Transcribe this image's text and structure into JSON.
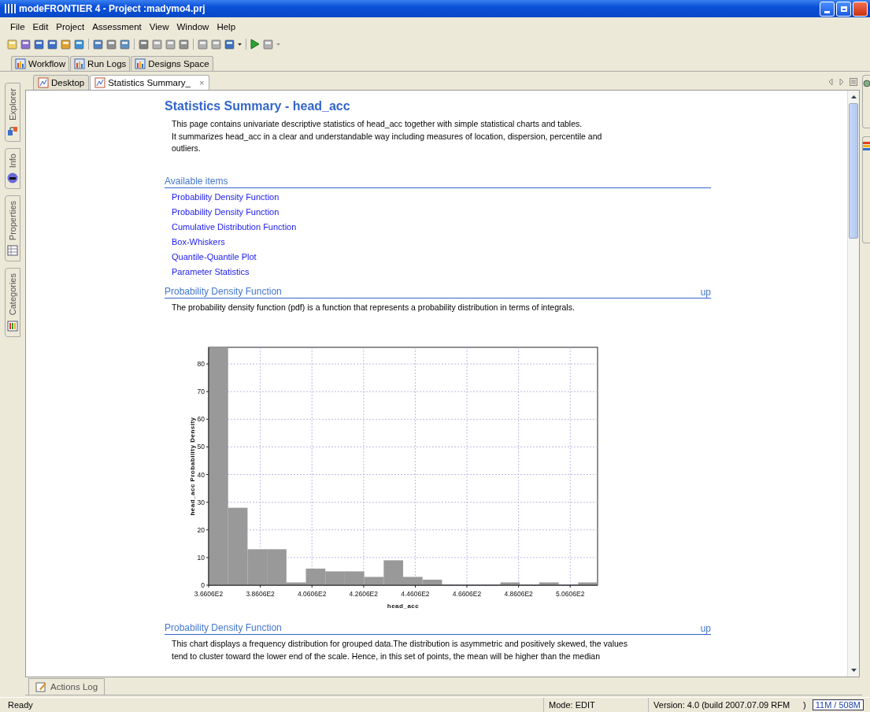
{
  "window": {
    "title": "modeFRONTIER 4 - Project :madymo4.prj"
  },
  "menu": [
    "File",
    "Edit",
    "Project",
    "Assessment",
    "View",
    "Window",
    "Help"
  ],
  "perspective_tabs": [
    {
      "label": "Workflow",
      "selected": false
    },
    {
      "label": "Run Logs",
      "selected": false
    },
    {
      "label": "Designs Space",
      "selected": false
    }
  ],
  "side_tabs": [
    {
      "label": "Explorer",
      "kind": "explorer"
    },
    {
      "label": "Info",
      "kind": "info"
    },
    {
      "label": "Properties",
      "kind": "properties"
    },
    {
      "label": "Categories",
      "kind": "categories"
    }
  ],
  "editor_tabs": [
    {
      "label": "Desktop",
      "selected": false
    },
    {
      "label": "Statistics Summary_",
      "selected": true,
      "close": "×"
    }
  ],
  "page": {
    "title": "Statistics Summary - head_acc",
    "intro": "This page contains univariate descriptive statistics of head_acc together with simple statistical charts and tables.\nIt summarizes head_acc in a clear and understandable way including measures of location, dispersion, percentile and\noutliers.",
    "available_items": {
      "heading": "Available items",
      "links": [
        "Probability Density Function",
        "Probability Density Function",
        "Cumulative Distribution Function",
        "Box-Whiskers",
        "Quantile-Quantile Plot",
        "Parameter Statistics"
      ]
    },
    "sections": [
      {
        "heading": "Probability Density Function",
        "up": "up",
        "text": "The probability density function (pdf) is a function that represents a probability distribution in terms of integrals.",
        "chart_data": {
          "type": "bar",
          "xlabel": "head_acc",
          "ylabel": "head_acc Probability Density",
          "x": [
            369.83,
            377.36,
            384.89,
            392.42,
            399.95,
            407.48,
            415.01,
            422.54,
            430.07,
            437.6,
            445.13,
            452.66,
            460.19,
            467.72,
            475.25,
            482.78,
            490.31,
            497.84,
            505.37,
            512.9
          ],
          "grid": true,
          "series": [
            {
              "color": "#999999",
              "values": [
                86,
                28,
                13,
                13,
                1,
                6,
                5,
                5,
                3,
                9,
                3,
                2,
                0,
                0,
                0,
                1,
                0,
                1,
                0,
                1
              ]
            }
          ],
          "xlim": [
            366.06,
            516.66
          ],
          "ylim": [
            0,
            86
          ],
          "xticks": [
            {
              "value": 366.06,
              "label": "3.6606E2"
            },
            {
              "value": 386.06,
              "label": "3.8606E2"
            },
            {
              "value": 406.06,
              "label": "4.0606E2"
            },
            {
              "value": 426.06,
              "label": "4.2606E2"
            },
            {
              "value": 446.06,
              "label": "4.4606E2"
            },
            {
              "value": 466.06,
              "label": "4.6606E2"
            },
            {
              "value": 486.06,
              "label": "4.8606E2"
            },
            {
              "value": 506.06,
              "label": "5.0606E2"
            }
          ],
          "yticks": [
            0,
            10,
            20,
            30,
            40,
            50,
            60,
            70,
            80
          ]
        }
      },
      {
        "heading": "Probability Density Function",
        "up": "up",
        "text": "This chart displays a frequency distribution for grouped data.The distribution is asymmetric and positively skewed, the values\ntend to cluster toward the lower end of the scale. Hence, in this set of points, the mean will be higher than the median"
      }
    ]
  },
  "actions_log": {
    "label": "Actions Log"
  },
  "status_bar": {
    "message": "Ready",
    "mode": "Mode: EDIT",
    "version": "Version: 4.0 (build 2007.07.09 RFM",
    "paren": ")",
    "memory": "11M / 508M"
  }
}
